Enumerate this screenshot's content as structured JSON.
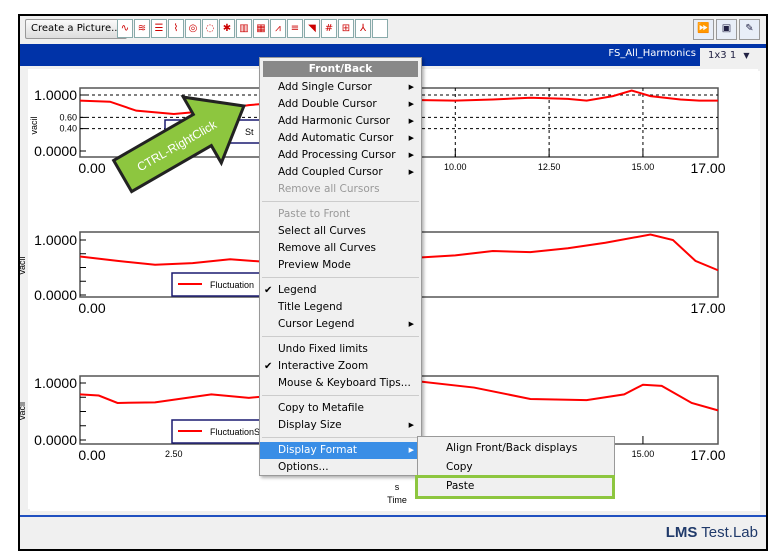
{
  "toolbar": {
    "create_picture": "Create a Picture...",
    "icons": [
      "line-plot",
      "bode-plot",
      "multi-plot",
      "waterfall-plot",
      "polar-plot",
      "nyquist-plot",
      "scatter-plot",
      "bar-plot",
      "colormap-plot",
      "spectrum-plot",
      "table-lines",
      "orbit-plot",
      "value-display",
      "matrix-display",
      "axes-3d",
      "blank-display"
    ],
    "right_icons": [
      "fast-forward",
      "new-picture",
      "edit"
    ]
  },
  "tabs": {
    "active": "FS_All_Harmonics",
    "layout": "1x3 1"
  },
  "charts": [
    {
      "ylabel": "vacil",
      "ytick_labels": [
        "1.0000",
        "0.60",
        "0.40",
        "0.0000"
      ],
      "yticks": [
        1,
        0.6,
        0.4,
        0
      ],
      "xticks": [
        {
          "v": 0,
          "l": "0.00"
        },
        {
          "v": 10,
          "l": "10.00"
        },
        {
          "v": 12.5,
          "l": "12.50"
        },
        {
          "v": 15,
          "l": "15.00"
        },
        {
          "v": 17,
          "l": "17.00"
        }
      ],
      "legend": "St",
      "grid": true,
      "points": [
        [
          0,
          0.9
        ],
        [
          0.8,
          0.88
        ],
        [
          1.5,
          0.72
        ],
        [
          2.5,
          0.66
        ],
        [
          3.5,
          0.72
        ],
        [
          4.5,
          0.82
        ],
        [
          6,
          0.9
        ],
        [
          8,
          0.92
        ],
        [
          10,
          0.9
        ],
        [
          11,
          0.92
        ],
        [
          12,
          0.95
        ],
        [
          13,
          0.93
        ],
        [
          13.5,
          0.9
        ],
        [
          14.2,
          0.98
        ],
        [
          14.7,
          1.08
        ],
        [
          15.2,
          0.98
        ],
        [
          16,
          0.92
        ],
        [
          16.5,
          0.9
        ],
        [
          17,
          0.9
        ]
      ]
    },
    {
      "ylabel": "vacil",
      "ytick_labels": [
        "1.0000",
        "0.0000"
      ],
      "yticks": [
        1,
        0
      ],
      "xticks": [
        {
          "v": 0,
          "l": "0.00"
        },
        {
          "v": 17,
          "l": "17.00"
        }
      ],
      "legend": "Fluctuation",
      "grid": false,
      "points": [
        [
          0,
          0.7
        ],
        [
          1,
          0.62
        ],
        [
          2,
          0.55
        ],
        [
          3,
          0.58
        ],
        [
          4,
          0.65
        ],
        [
          5,
          0.6
        ],
        [
          8,
          0.68
        ],
        [
          9,
          0.68
        ],
        [
          10,
          0.72
        ],
        [
          11,
          0.8
        ],
        [
          12,
          0.78
        ],
        [
          13,
          0.85
        ],
        [
          14,
          0.95
        ],
        [
          15.2,
          1.1
        ],
        [
          15.8,
          1.0
        ],
        [
          16.4,
          0.62
        ],
        [
          17,
          0.45
        ]
      ]
    },
    {
      "ylabel": "vacil",
      "ytick_labels": [
        "1.0000",
        "0.0000"
      ],
      "yticks": [
        1,
        0
      ],
      "xticks": [
        {
          "v": 0,
          "l": "0.00"
        },
        {
          "v": 2.5,
          "l": "2.50"
        },
        {
          "v": 15,
          "l": "15.00"
        },
        {
          "v": 17,
          "l": "17.00"
        }
      ],
      "legend": "FluctuationS",
      "grid": false,
      "xunit": "s",
      "xlabel": "Time",
      "points": [
        [
          0,
          0.8
        ],
        [
          0.5,
          0.78
        ],
        [
          1,
          0.65
        ],
        [
          2,
          0.66
        ],
        [
          3.5,
          0.8
        ],
        [
          4.5,
          0.74
        ],
        [
          8,
          0.95
        ],
        [
          9,
          1.03
        ],
        [
          10.5,
          0.92
        ],
        [
          12,
          0.72
        ],
        [
          13.5,
          0.7
        ],
        [
          14.5,
          0.8
        ],
        [
          15,
          0.97
        ],
        [
          15.5,
          0.95
        ],
        [
          16.3,
          0.65
        ],
        [
          17,
          0.52
        ]
      ]
    }
  ],
  "annotation": {
    "text": "CTRL-RightClick",
    "color": "#8dc63f"
  },
  "menu": {
    "header": "Front/Back",
    "items": [
      {
        "label": "Add Single Cursor",
        "sub": true
      },
      {
        "label": "Add Double Cursor",
        "sub": true
      },
      {
        "label": "Add Harmonic Cursor",
        "sub": true
      },
      {
        "label": "Add Automatic Cursor",
        "sub": true
      },
      {
        "label": "Add Processing Cursor",
        "sub": true
      },
      {
        "label": "Add Coupled Cursor",
        "sub": true
      },
      {
        "label": "Remove all Cursors",
        "disabled": true
      },
      {
        "sep": true
      },
      {
        "label": "Paste to Front",
        "disabled": true
      },
      {
        "label": "Select all Curves"
      },
      {
        "label": "Remove all Curves"
      },
      {
        "label": "Preview Mode"
      },
      {
        "sep": true
      },
      {
        "label": "Legend",
        "checked": true
      },
      {
        "label": "Title Legend"
      },
      {
        "label": "Cursor Legend",
        "sub": true
      },
      {
        "sep": true
      },
      {
        "label": "Undo Fixed limits"
      },
      {
        "label": "Interactive Zoom",
        "checked": true
      },
      {
        "label": "Mouse & Keyboard Tips..."
      },
      {
        "sep": true
      },
      {
        "label": "Copy to Metafile"
      },
      {
        "label": "Display Size",
        "sub": true
      },
      {
        "sep": true
      },
      {
        "label": "Display Format",
        "sub": true,
        "selected": true
      },
      {
        "label": "Options..."
      }
    ]
  },
  "submenu": {
    "items": [
      "Align Front/Back displays",
      "Copy",
      "Paste"
    ],
    "highlighted": "Paste",
    "highlight_color": "#8dc63f"
  },
  "brand": {
    "bold": "LMS",
    "rest": "Test.Lab"
  },
  "colors": {
    "curve": "#ff0000",
    "titlebar": "#0033a8",
    "menu_selected": "#3a8ee6"
  }
}
